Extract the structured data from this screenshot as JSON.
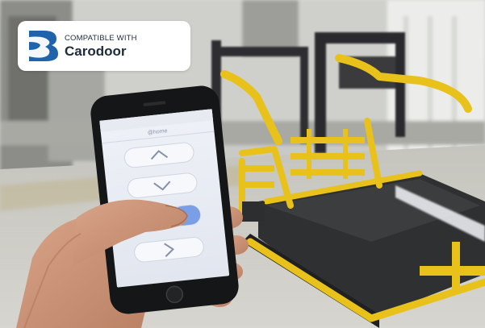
{
  "badge": {
    "kicker": "COMPATIBLE WITH",
    "brand": "Carodoor",
    "logo_icon": "carodoor-logo-icon",
    "logo_color": "#1f63ad"
  },
  "phone_app": {
    "screen_title": "@home",
    "controls": [
      "chevron-up-icon",
      "chevron-down-icon",
      "toggle-switch",
      "chevron-right-icon"
    ],
    "accent_color": "#7a9fe6"
  },
  "scene": {
    "frame_color": "#e8c21a",
    "floor_color": "#bdbcb5",
    "ramp_color": "#2f3032"
  }
}
